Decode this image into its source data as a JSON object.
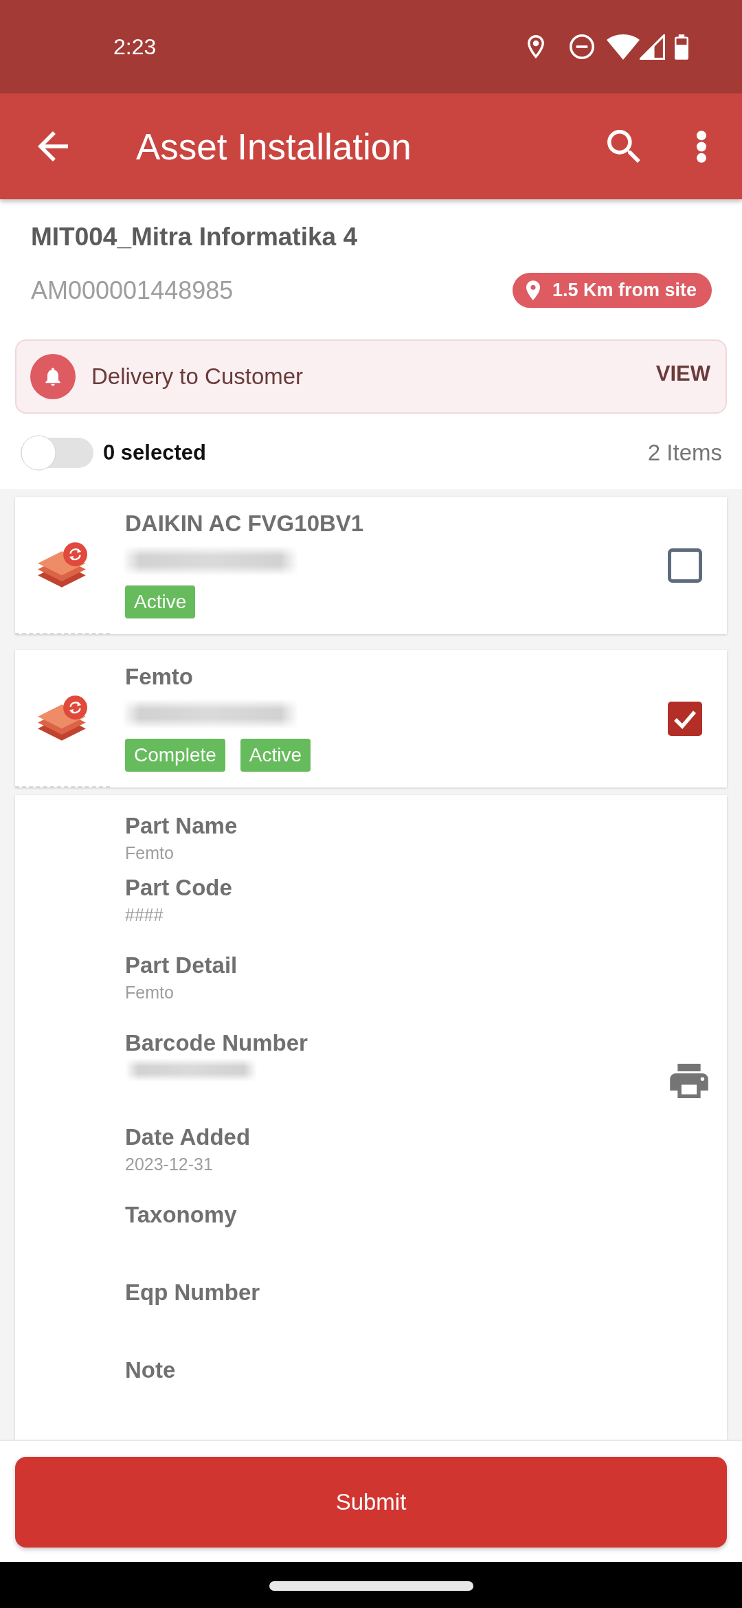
{
  "status_bar": {
    "time": "2:23"
  },
  "app_bar": {
    "title": "Asset Installation"
  },
  "site": {
    "name": "MIT004_Mitra Informatika 4",
    "code": "AM000001448985",
    "distance": "1.5 Km from site"
  },
  "notice": {
    "text": "Delivery to Customer",
    "action": "VIEW"
  },
  "selection": {
    "on": false,
    "selected_label": "0 selected",
    "total_label": "2 Items"
  },
  "items": [
    {
      "name": "DAIKIN AC FVG10BV1",
      "tags": [
        "Active"
      ],
      "checked": false
    },
    {
      "name": "Femto",
      "tags": [
        "Complete",
        "Active"
      ],
      "checked": true,
      "details": [
        {
          "kind": "text",
          "label": "Part Name",
          "value": "Femto"
        },
        {
          "kind": "text",
          "label": "Part Code",
          "value": "####"
        },
        {
          "kind": "text",
          "label": "Part Detail",
          "value": "Femto"
        },
        {
          "kind": "barcode",
          "label": "Barcode Number"
        },
        {
          "kind": "text",
          "label": "Date Added",
          "value": "2023-12-31"
        },
        {
          "kind": "text",
          "label": "Taxonomy"
        },
        {
          "kind": "text",
          "label": "Eqp Number"
        },
        {
          "kind": "text",
          "label": "Note"
        }
      ]
    }
  ],
  "submit_button": "Submit"
}
